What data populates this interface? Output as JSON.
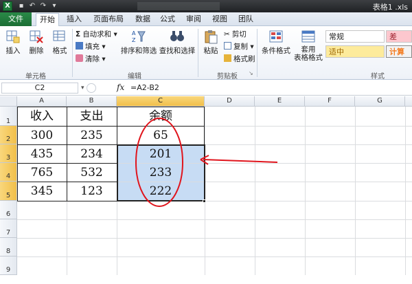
{
  "window": {
    "title": "表格1 .xls",
    "app_letter": "X"
  },
  "tabs": {
    "file": "文件",
    "items": [
      "开始",
      "插入",
      "页面布局",
      "数据",
      "公式",
      "审阅",
      "视图",
      "团队"
    ],
    "active": 0
  },
  "ribbon": {
    "cells_group": {
      "label": "单元格",
      "insert": "插入",
      "delete": "删除",
      "format": "格式"
    },
    "edit_group": {
      "label": "编辑",
      "autosum": "自动求和",
      "fill": "填充",
      "clear": "清除",
      "sort_filter": "排序和筛选",
      "find_select": "查找和选择"
    },
    "clipboard_group": {
      "label": "剪贴板",
      "paste": "粘贴",
      "cut": "剪切",
      "copy": "复制",
      "format_painter": "格式刷"
    },
    "styles_group": {
      "label": "样式",
      "conditional": "条件格式",
      "table_format_1": "套用",
      "table_format_2": "表格格式",
      "normal": "常规",
      "bad": "差",
      "neutral": "适中",
      "calculation": "计算"
    }
  },
  "formula_bar": {
    "name_box": "C2",
    "fx": "fx",
    "formula": "=A2-B2"
  },
  "grid": {
    "columns": [
      "A",
      "B",
      "C",
      "D",
      "E",
      "F",
      "G"
    ],
    "rows": [
      "1",
      "2",
      "3",
      "4",
      "5",
      "6",
      "7",
      "8",
      "9"
    ],
    "header": [
      "收入",
      "支出",
      "余额"
    ],
    "data": [
      [
        "300",
        "235",
        "65"
      ],
      [
        "435",
        "234",
        "201"
      ],
      [
        "765",
        "532",
        "233"
      ],
      [
        "345",
        "123",
        "222"
      ]
    ]
  },
  "colors": {
    "excel_green": "#1e7b3a",
    "selection": "#c7dcf4",
    "annotation_red": "#e0141c",
    "header_selected": "#f1bf4a"
  }
}
